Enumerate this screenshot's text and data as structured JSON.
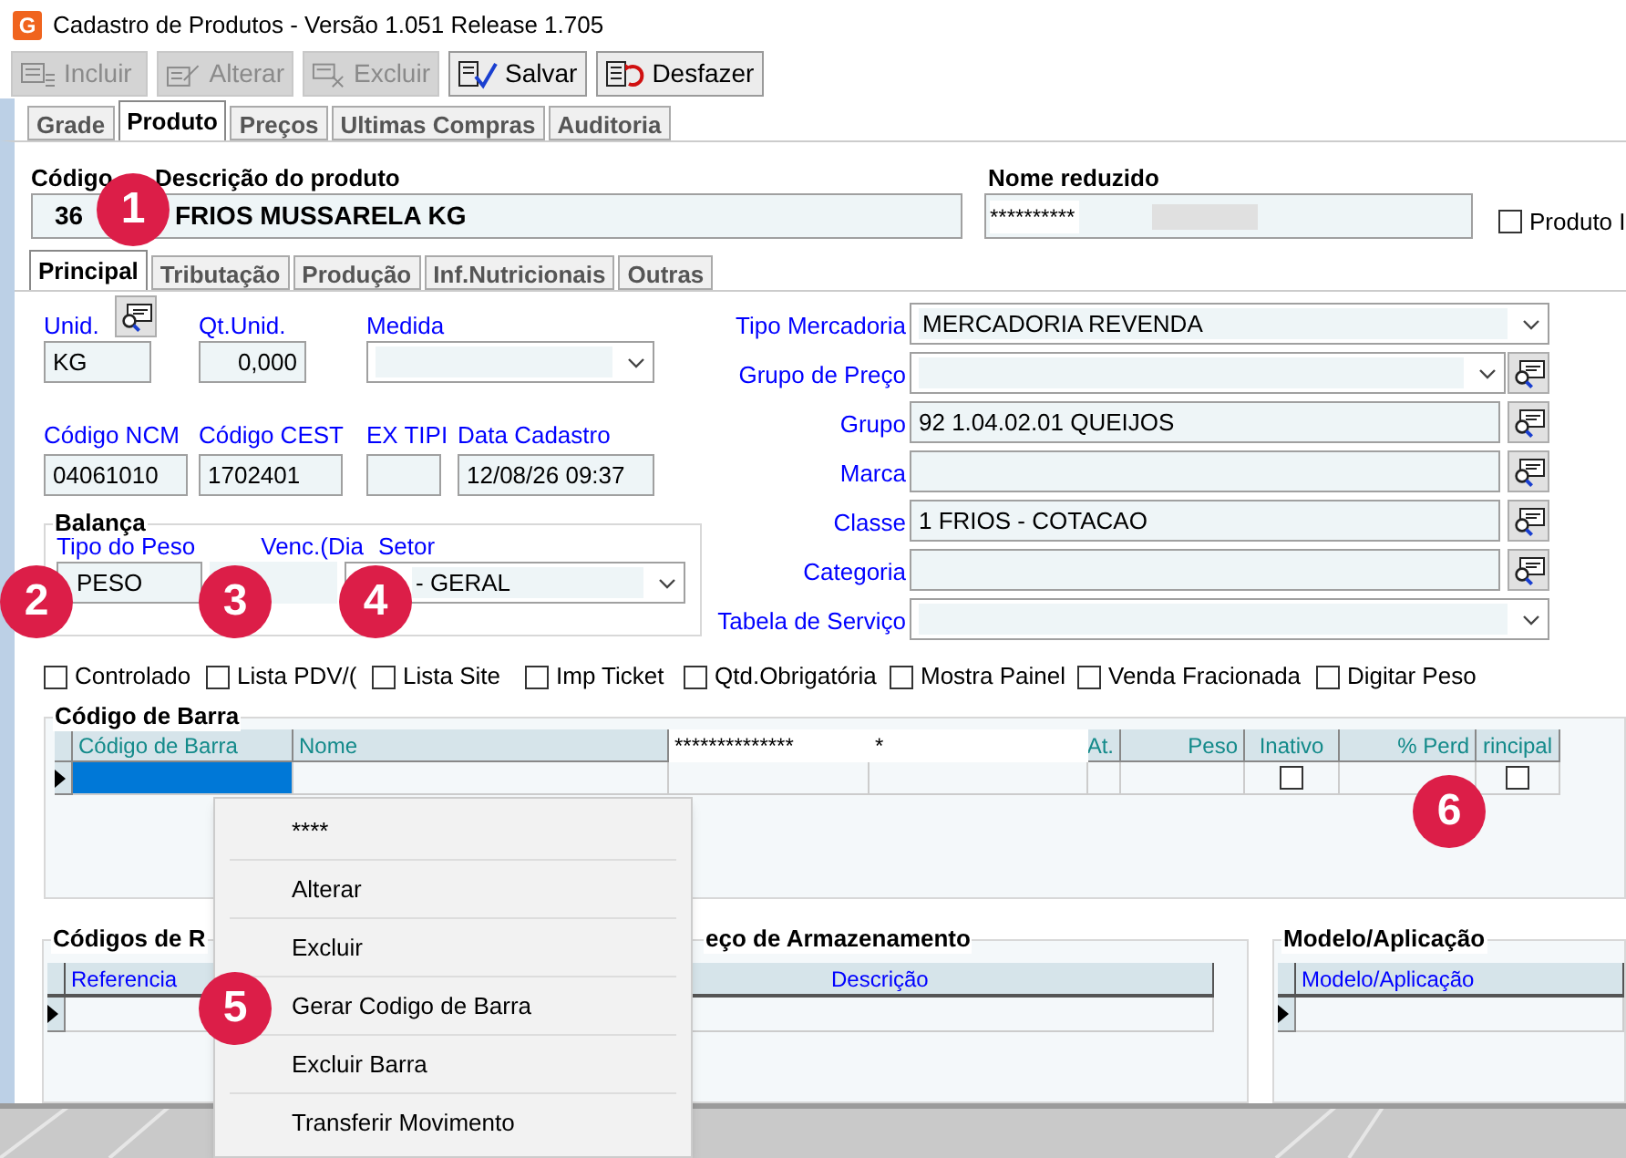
{
  "window": {
    "app_icon": "G",
    "title": "Cadastro de Produtos - Versão 1.051 Release 1.705"
  },
  "toolbar": [
    {
      "label": "Incluir",
      "kind": "add",
      "disabled": true
    },
    {
      "label": "Alterar",
      "kind": "edit",
      "disabled": true
    },
    {
      "label": "Excluir",
      "kind": "delete",
      "disabled": true
    },
    {
      "label": "Salvar",
      "kind": "save",
      "disabled": false
    },
    {
      "label": "Desfazer",
      "kind": "undo",
      "disabled": false
    }
  ],
  "main_tabs": [
    {
      "label": "Grade",
      "selected": false
    },
    {
      "label": "Produto",
      "selected": true
    },
    {
      "label": "Preços",
      "selected": false
    },
    {
      "label": "Ultimas Compras",
      "selected": false
    },
    {
      "label": "Auditoria",
      "selected": false
    }
  ],
  "header": {
    "codigo": {
      "label": "Código",
      "value": "36"
    },
    "descricao": {
      "label": "Descrição do produto",
      "value": "FRIOS MUSSARELA KG"
    },
    "nome_reduzido": {
      "label": "Nome reduzido",
      "value": "**********"
    },
    "produto_checkbox": {
      "label": "Produto I",
      "checked": false
    }
  },
  "sub_tabs": [
    {
      "label": "Principal",
      "selected": true
    },
    {
      "label": "Tributação",
      "selected": false
    },
    {
      "label": "Produção",
      "selected": false
    },
    {
      "label": "Inf.Nutricionais",
      "selected": false
    },
    {
      "label": "Outras",
      "selected": false
    }
  ],
  "left_fields": {
    "unid": {
      "label": "Unid.",
      "value": "KG"
    },
    "qt_unid": {
      "label": "Qt.Unid.",
      "value": "0,000"
    },
    "medida": {
      "label": "Medida"
    },
    "codigo_ncm": {
      "label": "Código NCM",
      "value": "04061010"
    },
    "codigo_cest": {
      "label": "Código CEST",
      "value": "1702401"
    },
    "ex_tipi": {
      "label": "EX TIPI"
    },
    "data_cadastro": {
      "label": "Data Cadastro",
      "value": "12/08/26 09:37"
    }
  },
  "balanca": {
    "title": "Balança",
    "tipo_peso": {
      "label": "Tipo do Peso",
      "value": "PESO"
    },
    "venc": {
      "label": "Venc.(Dia"
    },
    "setor": {
      "label": "Setor",
      "value": "- GERAL"
    }
  },
  "right_fields": [
    {
      "label": "Tipo Mercadoria",
      "value": "MERCADORIA REVENDA",
      "kind": "dropdown"
    },
    {
      "label": "Grupo de Preço",
      "kind": "dropdown_lookup"
    },
    {
      "label": "Grupo",
      "value": "92 1.04.02.01 QUEIJOS",
      "kind": "lookup"
    },
    {
      "label": "Marca",
      "kind": "lookup"
    },
    {
      "label": "Classe",
      "value": "1 FRIOS - COTACAO",
      "kind": "lookup"
    },
    {
      "label": "Categoria",
      "kind": "lookup"
    },
    {
      "label": "Tabela de Serviço",
      "kind": "dropdown"
    }
  ],
  "options": [
    {
      "label": "Controlado",
      "checked": false
    },
    {
      "label": "Lista PDV/(",
      "checked": false
    },
    {
      "label": "Lista Site",
      "checked": false
    },
    {
      "label": "Imp Ticket",
      "checked": false
    },
    {
      "label": "Qtd.Obrigatória",
      "checked": false
    },
    {
      "label": "Mostra Painel",
      "checked": false
    },
    {
      "label": "Venda Fracionada",
      "checked": false
    },
    {
      "label": "Digitar Peso",
      "checked": false
    }
  ],
  "barcode": {
    "title": "Código de Barra",
    "columns": [
      {
        "label": "Código de Barra"
      },
      {
        "label": "Nome"
      },
      {
        "label": "**************"
      },
      {
        "label": "*"
      },
      {
        "label": "At."
      },
      {
        "label": "Peso"
      },
      {
        "label": "Inativo"
      },
      {
        "label": "% Perd"
      },
      {
        "label": "rincipal"
      }
    ],
    "rows": [
      {
        "selected": true,
        "inativo": false,
        "principal": false
      }
    ]
  },
  "lower_groups": [
    {
      "title": "Códigos de R",
      "column": "Referencia"
    },
    {
      "title": "eço de Armazenamento",
      "column": "Descrição"
    },
    {
      "title": "Modelo/Aplicação",
      "column": "Modelo/Aplicação"
    }
  ],
  "context_menu": [
    {
      "label": "****"
    },
    {
      "label": "Alterar"
    },
    {
      "label": "Excluir"
    },
    {
      "label": "Gerar Codigo de Barra"
    },
    {
      "label": "Excluir Barra"
    },
    {
      "label": "Transferir Movimento"
    }
  ],
  "markers": [
    {
      "label": "1"
    },
    {
      "label": "2"
    },
    {
      "label": "3"
    },
    {
      "label": "4"
    },
    {
      "label": "5"
    },
    {
      "label": "6"
    }
  ]
}
